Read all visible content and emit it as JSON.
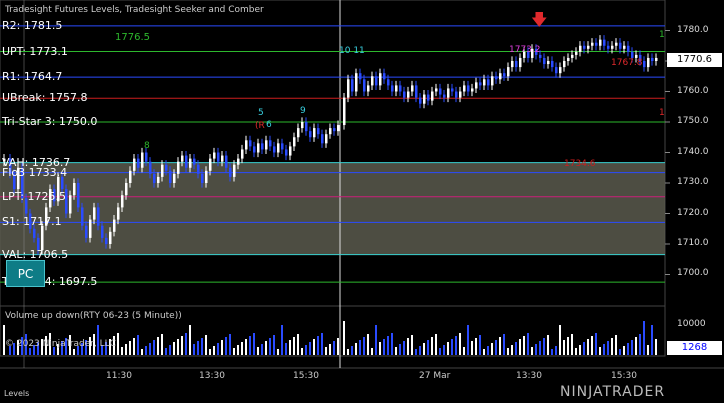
{
  "title": "Tradesight Futures Levels, Tradesight Seeker and Comber",
  "levels": [
    {
      "name": "R2",
      "label": "R2: 1781.5",
      "value": 1781.5,
      "color": "#2a4bff"
    },
    {
      "name": "UPT",
      "label": "UPT: 1773.1",
      "value": 1773.1,
      "color": "#2db82d"
    },
    {
      "name": "R1",
      "label": "R1: 1764.7",
      "value": 1764.7,
      "color": "#2a4bff"
    },
    {
      "name": "UBreak",
      "label": "UBreak: 1757.8",
      "value": 1757.8,
      "color": "#cc1e1e"
    },
    {
      "name": "TriStar3",
      "label": "Tri-Star 3: 1750.0",
      "value": 1750.0,
      "color": "#2db82d"
    },
    {
      "name": "VAH",
      "label": "VAH: 1736.7",
      "value": 1736.7,
      "color": "#39d0d0"
    },
    {
      "name": "POC",
      "label": "Flo3 1733.4",
      "value": 1733.4,
      "color": "#2a4bff"
    },
    {
      "name": "LPT",
      "label": "LPT: 1725.5",
      "value": 1725.5,
      "color": "#cc1e7a"
    },
    {
      "name": "S1",
      "label": "S1: 1717.1",
      "value": 1717.1,
      "color": "#2a4bff"
    },
    {
      "name": "VAL",
      "label": "VAL: 1706.5",
      "value": 1706.5,
      "color": "#39d0d0"
    },
    {
      "name": "TriStar4",
      "label": "Tri-Star 4: 1697.5",
      "value": 1697.5,
      "color": "#2db82d"
    }
  ],
  "upt_box_label": "1776.5",
  "r_mid_label": "1734.6",
  "y_axis_ticks": [
    "1780.0",
    "1770.0",
    "1760.0",
    "1750.0",
    "1740.0",
    "1730.0",
    "1720.0",
    "1710.0",
    "1700.0"
  ],
  "current_price": "1770.6",
  "volume_title": "Volume up down(RTY 06-23 (5 Minute))",
  "volume_axis": "10000",
  "volume_current": "1268",
  "copyright": "© 2023 NinjaTrader, LLC",
  "x_labels": [
    "11:30",
    "13:30",
    "15:30",
    "27 Mar",
    "13:30",
    "15:30"
  ],
  "pc_button": "PC",
  "status_tab": "Levels",
  "brand": "NINJATRADER",
  "annotations": {
    "s10": "10",
    "s11": "11",
    "s5": "5",
    "s8": "8",
    "s9": "9",
    "s1": "1",
    "s1773": "1773.2",
    "s1767": "1767.8",
    "r_box": "(R",
    "d6": "6"
  },
  "colors": {
    "background": "#000000",
    "up": "#ffffff",
    "down": "#2a4bff",
    "range_box": "#5a5a4e"
  }
}
